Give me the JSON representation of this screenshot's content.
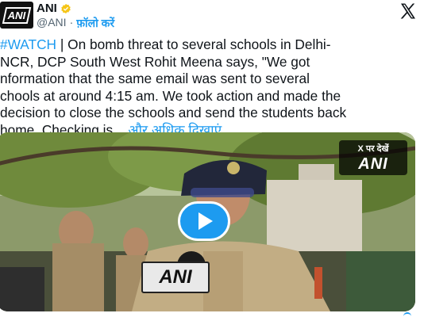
{
  "account": {
    "name": "ANI",
    "handle": "@ANI",
    "separator": "·",
    "follow_label": "फ़ॉलो करें",
    "avatar_text": "ANI",
    "verified_color": "#f5c518"
  },
  "tweet": {
    "lines": [
      {
        "hashtag": "#WATCH",
        "text": " | On bomb threat to several schools in Delhi-"
      },
      {
        "hashtag": "",
        "text": "NCR, DCP South West Rohit Meena says, \"We got"
      },
      {
        "hashtag": "",
        "text": "nformation that the same email was sent to several"
      },
      {
        "hashtag": "",
        "text": "chools at around 4:15 am. We took action and made the"
      },
      {
        "hashtag": "",
        "text": "decision to close the schools and send the students back"
      },
      {
        "hashtag": "",
        "text": "home. Checking is... "
      }
    ],
    "show_more_label": "और अधिक दिखाएं"
  },
  "media": {
    "view_on_x_label": "X पर देखें",
    "watermark_text": "ANI",
    "mic_label_text": "ANI",
    "play_icon": "play-icon"
  },
  "colors": {
    "accent": "#1d9bf0",
    "text": "#0f1419",
    "secondary_text": "#536471"
  }
}
